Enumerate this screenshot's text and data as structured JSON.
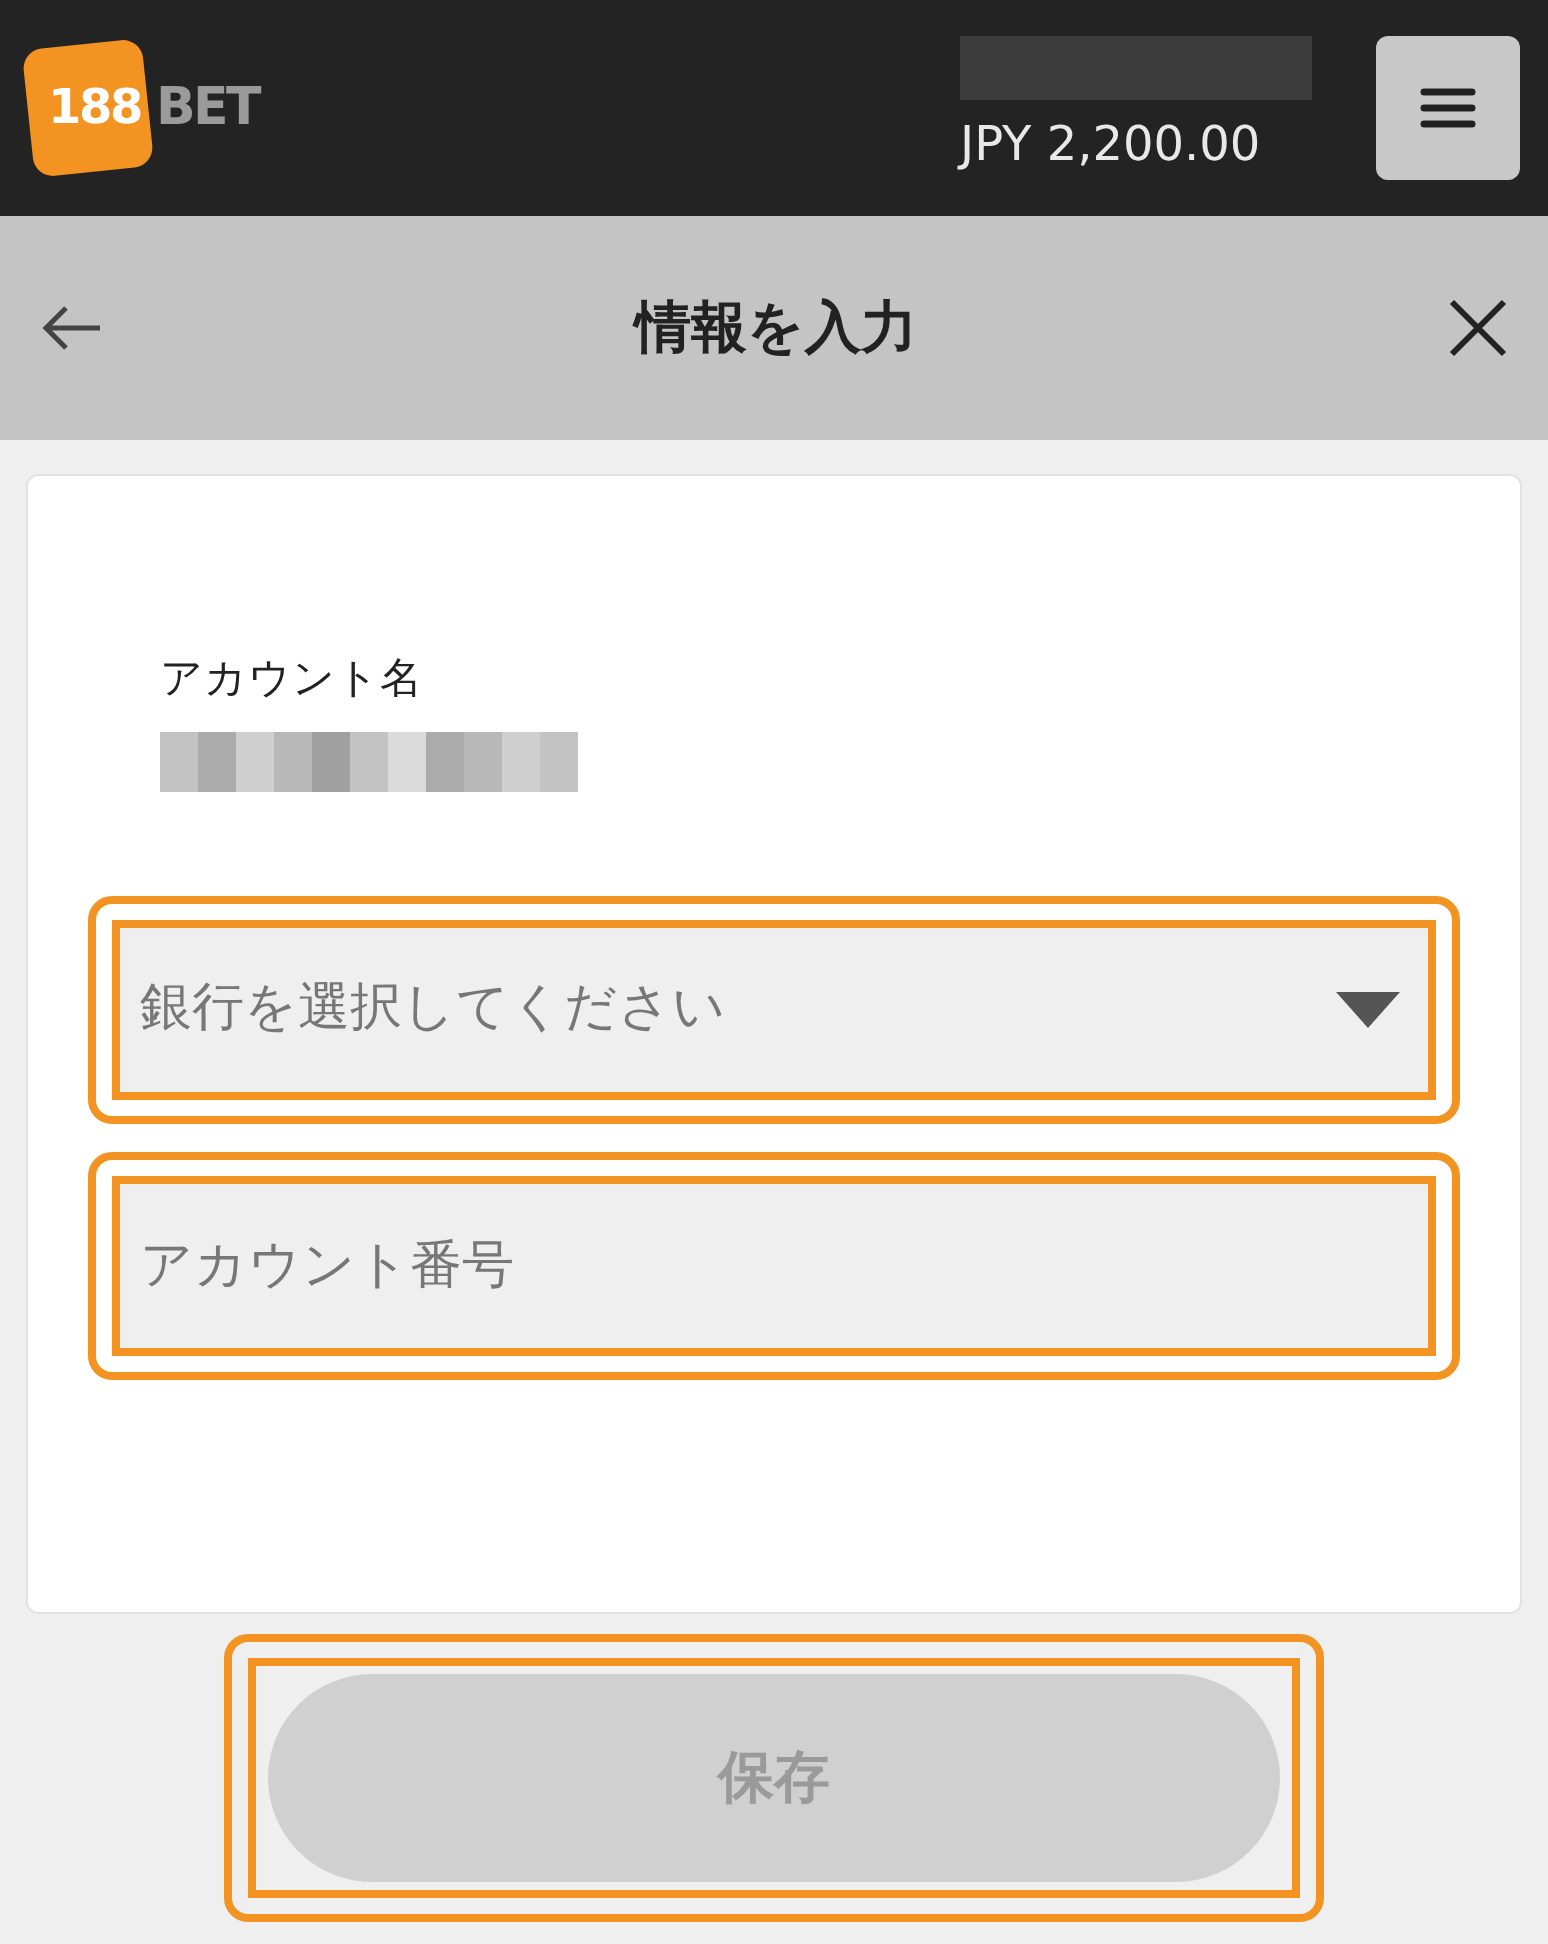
{
  "header": {
    "logo": {
      "number": "188",
      "word": "BET"
    },
    "balance": "JPY 2,200.00"
  },
  "title_bar": {
    "title": "情報を入力"
  },
  "form": {
    "account_name_label": "アカウント名",
    "fields": [
      {
        "kind": "select",
        "placeholder": "銀行を選択してください",
        "highlighted": true
      },
      {
        "kind": "text",
        "placeholder": "アカウント番号",
        "highlighted": true
      }
    ]
  },
  "save_button": {
    "label": "保存",
    "disabled": true,
    "highlighted": true
  }
}
